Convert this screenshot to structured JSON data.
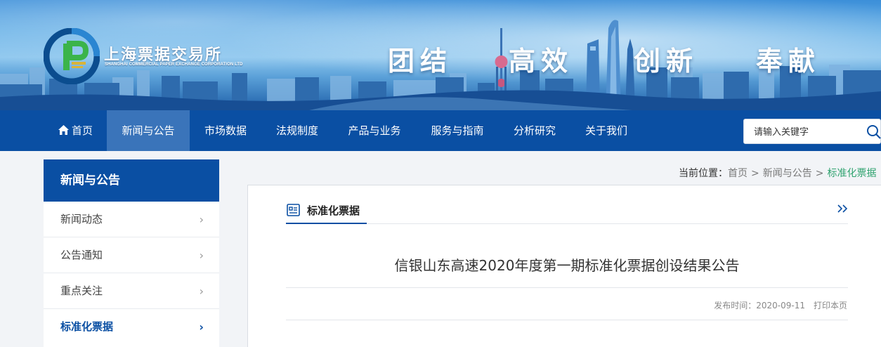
{
  "brand": {
    "name_cn": "上海票据交易所",
    "name_en": "SHANGHAI COMMERCIAL PAPER EXCHANGE CORPORATION LTD",
    "logo_icon": "scpe-logo"
  },
  "slogans": [
    "团结",
    "高效",
    "创新",
    "奉献"
  ],
  "nav": {
    "items": [
      {
        "label": "首页",
        "icon": "home-icon"
      },
      {
        "label": "新闻与公告",
        "active": true
      },
      {
        "label": "市场数据"
      },
      {
        "label": "法规制度"
      },
      {
        "label": "产品与业务"
      },
      {
        "label": "服务与指南"
      },
      {
        "label": "分析研究"
      },
      {
        "label": "关于我们"
      }
    ],
    "search_placeholder": "请输入关键字"
  },
  "sidebar": {
    "title": "新闻与公告",
    "items": [
      {
        "label": "新闻动态"
      },
      {
        "label": "公告通知"
      },
      {
        "label": "重点关注"
      },
      {
        "label": "标准化票据",
        "active": true
      }
    ]
  },
  "breadcrumb": {
    "prefix": "当前位置：",
    "items": [
      "首页",
      "新闻与公告",
      "标准化票据"
    ],
    "separator": ">"
  },
  "section": {
    "title": "标准化票据",
    "more_icon": "double-chevron-right-icon"
  },
  "article": {
    "title": "信银山东高速2020年度第一期标准化票据创设结果公告",
    "publish_label": "发布时间：",
    "publish_date": "2020-09-11",
    "print_label": "打印本页"
  },
  "colors": {
    "primary": "#0a4fa3",
    "nav_active": "#3a74ba",
    "breadcrumb_current": "#2ea26e",
    "logo_green": "#3bb44a"
  }
}
